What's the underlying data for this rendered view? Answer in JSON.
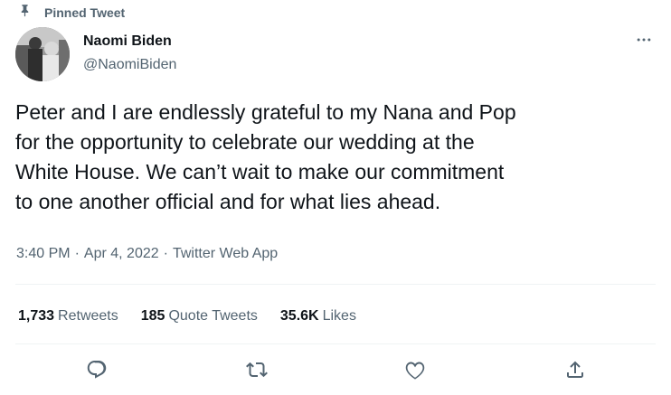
{
  "pinned": {
    "label": "Pinned Tweet",
    "icon": "pin-icon"
  },
  "author": {
    "display_name": "Naomi Biden",
    "handle": "@NaomiBiden"
  },
  "tweet": {
    "text": "Peter and I are endlessly grateful to my Nana and Pop\nfor the opportunity to celebrate our wedding at the\nWhite House. We can’t wait to make our commitment\nto one another official and for what lies ahead.",
    "time": "3:40 PM",
    "date": "Apr 4, 2022",
    "source": "Twitter Web App",
    "separator": "·"
  },
  "stats": {
    "retweets": {
      "count": "1,733",
      "label": "Retweets"
    },
    "quotes": {
      "count": "185",
      "label": "Quote Tweets"
    },
    "likes": {
      "count": "35.6K",
      "label": "Likes"
    }
  },
  "actions": [
    "reply-icon",
    "retweet-icon",
    "like-icon",
    "share-icon"
  ],
  "colors": {
    "text_primary": "#0f1419",
    "text_secondary": "#536471",
    "divider": "#eff3f4"
  }
}
